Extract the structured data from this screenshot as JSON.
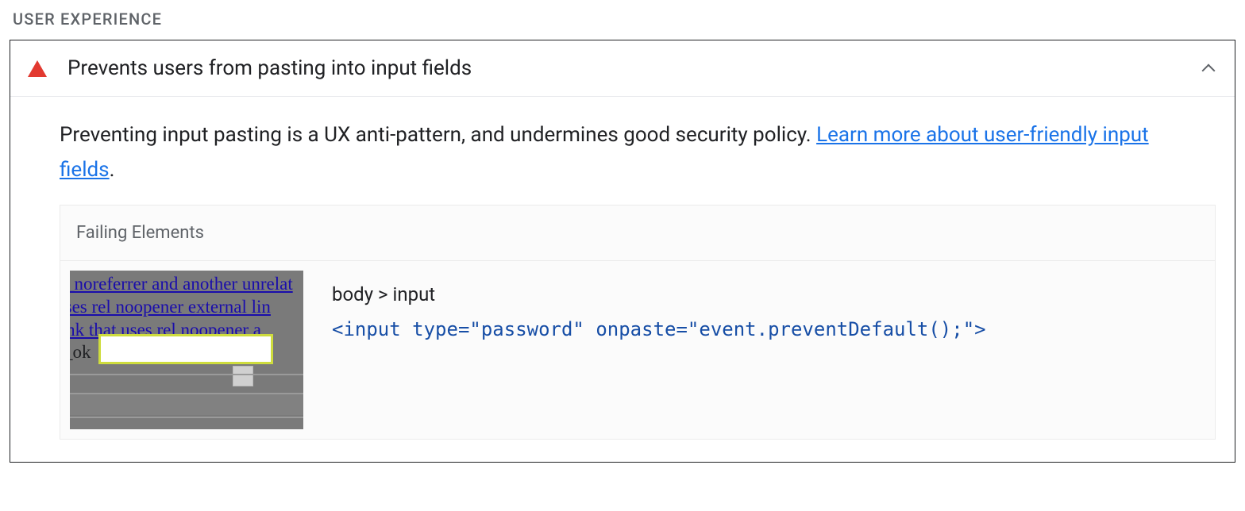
{
  "section": {
    "title": "USER EXPERIENCE"
  },
  "audit": {
    "title": "Prevents users from pasting into input fields",
    "description_text": "Preventing input pasting is a UX anti-pattern, and undermines good security policy. ",
    "link_text": "Learn more about user-friendly input fields",
    "period": ".",
    "failing": {
      "header": "Failing Elements",
      "selector": "body > input",
      "code": "<input type=\"password\" onpaste=\"event.preventDefault();\">",
      "thumbnail_text": {
        "l1": "_noreferrer and another unrelat",
        "l2": "t uses rel noopener external lin",
        "l3": "al link that uses rel noopener a",
        "l4": "_ok"
      }
    }
  },
  "icons": {
    "warning": "warning-triangle",
    "chevron": "chevron-up"
  },
  "colors": {
    "warning": "#e23930",
    "link": "#1a73e8",
    "code": "#174ea6"
  }
}
